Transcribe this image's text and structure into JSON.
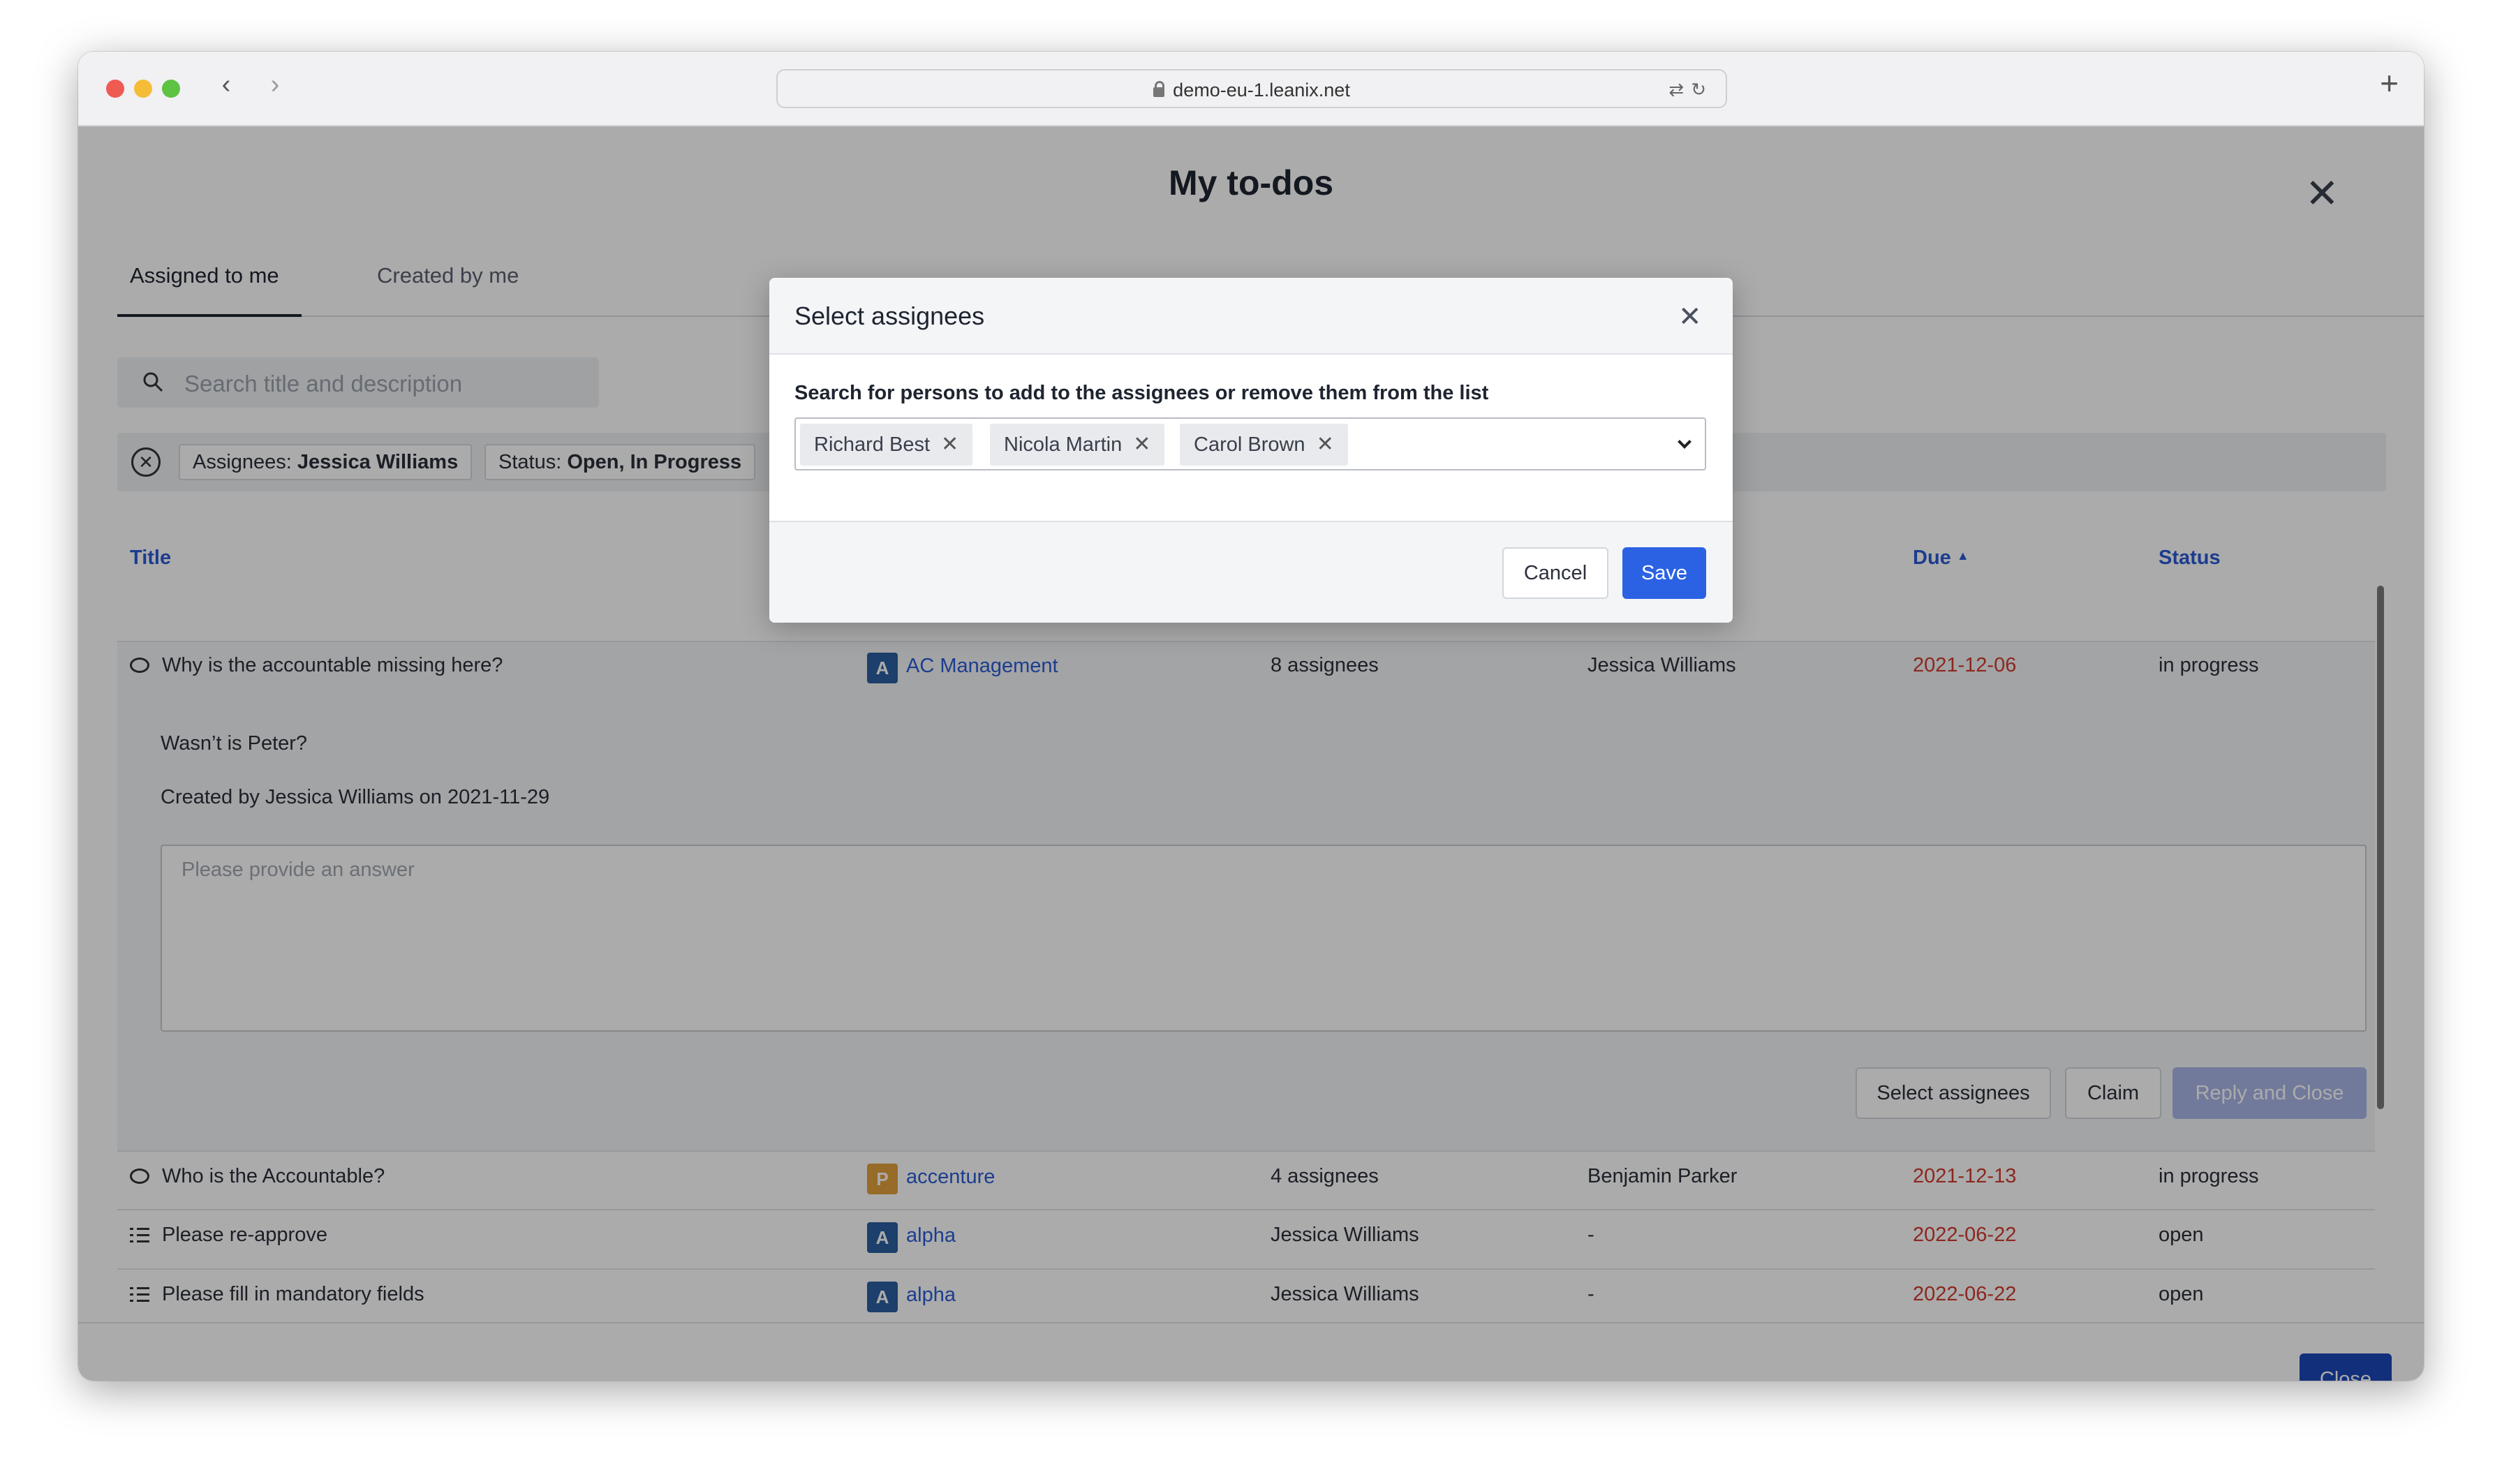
{
  "browser": {
    "url": "demo-eu-1.leanix.net",
    "back_icon": "‹",
    "forward_icon": "›",
    "new_tab_icon": "+",
    "url_icons": "⇄↻"
  },
  "page": {
    "title": "My to-dos",
    "close_icon": "✕",
    "tabs": [
      {
        "label": "Assigned to me"
      },
      {
        "label": "Created by me"
      }
    ],
    "search_placeholder": "Search title and description",
    "filters": {
      "clear_icon": "✕",
      "assignees_label": "Assignees:",
      "assignees_value": "Jessica Williams",
      "status_label": "Status:",
      "status_value_1": "Open,",
      "status_value_2": "In Progress"
    },
    "table": {
      "headers": {
        "title": "Title",
        "due": "Due",
        "due_sort_icon": "▲",
        "status": "Status"
      },
      "rows": [
        {
          "icon": "comment",
          "title": "Why is the accountable missing here?",
          "fs_badge": "A",
          "fs_name": "AC Management",
          "assignees": "8 assignees",
          "creator": "Jessica Williams",
          "due": "2021-12-06",
          "status": "in progress"
        },
        {
          "icon": "comment",
          "title": "Who is the Accountable?",
          "fs_badge": "P",
          "fs_name": "accenture",
          "assignees": "4 assignees",
          "creator": "Benjamin Parker",
          "due": "2021-12-13",
          "status": "in progress"
        },
        {
          "icon": "list",
          "title": "Please re-approve",
          "fs_badge": "A",
          "fs_name": "alpha",
          "assignees": "Jessica Williams",
          "creator": "-",
          "due": "2022-06-22",
          "status": "open"
        },
        {
          "icon": "list",
          "title": "Please fill in mandatory fields",
          "fs_badge": "A",
          "fs_name": "alpha",
          "assignees": "Jessica Williams",
          "creator": "-",
          "due": "2022-06-22",
          "status": "open"
        }
      ]
    },
    "expanded": {
      "description": "Wasn’t is Peter?",
      "created_by": "Created by Jessica Williams on 2021-11-29",
      "answer_placeholder": "Please provide an answer",
      "select_assignees_label": "Select assignees",
      "claim_label": "Claim",
      "reply_close_label": "Reply and Close"
    },
    "footer": {
      "close_label": "Close"
    }
  },
  "modal": {
    "title": "Select assignees",
    "close_icon": "✕",
    "instruction": "Search for persons to add to the assignees or remove them from the list",
    "selected": [
      {
        "name": "Richard Best"
      },
      {
        "name": "Nicola Martin"
      },
      {
        "name": "Carol Brown"
      }
    ],
    "remove_icon": "✕",
    "cancel_label": "Cancel",
    "save_label": "Save"
  },
  "colors": {
    "accent": "#2b62e3",
    "link": "#2b5bd6",
    "overdue": "#d13b2f",
    "badge_application": "#2a5ea0",
    "badge_provider": "#e2a13c"
  }
}
